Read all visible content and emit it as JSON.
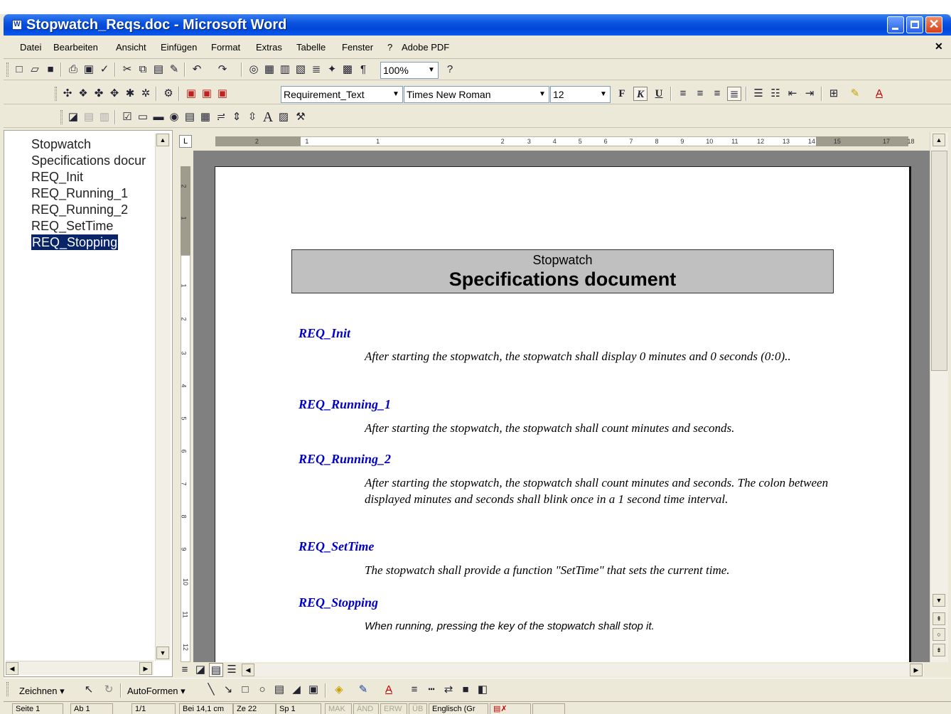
{
  "window": {
    "title": "Stopwatch_Reqs.doc - Microsoft Word"
  },
  "menu": [
    "Datei",
    "Bearbeiten",
    "Ansicht",
    "Einfügen",
    "Format",
    "Extras",
    "Tabelle",
    "Fenster",
    "?",
    "Adobe PDF"
  ],
  "toolbar": {
    "zoom": "100%",
    "style": "Requirement_Text",
    "font": "Times New Roman",
    "size": "12",
    "bold": "F",
    "italic": "K",
    "underline": "U"
  },
  "navigation": {
    "items": [
      "Stopwatch",
      "Specifications docur",
      "REQ_Init",
      "REQ_Running_1",
      "REQ_Running_2",
      "REQ_SetTime",
      "REQ_Stopping"
    ],
    "selected_index": 6
  },
  "document": {
    "heading_small": "Stopwatch",
    "heading_big": "Specifications document",
    "requirements": [
      {
        "id": "REQ_Init",
        "text": "After starting the stopwatch, the stopwatch shall display 0 minutes and 0 seconds (0:0).."
      },
      {
        "id": "REQ_Running_1",
        "text": "After starting the stopwatch, the stopwatch shall count minutes and seconds."
      },
      {
        "id": "REQ_Running_2",
        "text": "After starting the stopwatch, the stopwatch shall count minutes and seconds. The colon between displayed minutes and seconds shall blink once in a 1 second time interval."
      },
      {
        "id": "REQ_SetTime",
        "text": "The stopwatch shall provide a function \"SetTime\" that sets the current time."
      },
      {
        "id": "REQ_Stopping",
        "text": "When running, pressing the key of the stopwatch shall stop it."
      }
    ]
  },
  "ruler": {
    "h_labels": [
      "2",
      "1",
      "1",
      "2",
      "3",
      "4",
      "5",
      "6",
      "7",
      "8",
      "9",
      "10",
      "11",
      "12",
      "13",
      "14",
      "15",
      "17",
      "18"
    ],
    "v_labels": [
      "2",
      "1",
      "1",
      "2",
      "3",
      "4",
      "5",
      "6",
      "7",
      "8",
      "9",
      "10",
      "11",
      "12"
    ]
  },
  "drawing": {
    "draw_label": "Zeichnen",
    "autoshapes_label": "AutoFormen"
  },
  "status": {
    "page": "Seite 1",
    "section": "Ab 1",
    "pages": "1/1",
    "position": "Bei 14,1 cm",
    "line": "Ze 22",
    "column": "Sp 1",
    "mak": "MAK",
    "and": "ÄND",
    "erw": "ERW",
    "ub": "ÜB",
    "language": "Englisch (Gr"
  },
  "colors": {
    "title_blue": "#0a54e0",
    "req_blue": "#0000c8",
    "selection": "#0a246a"
  }
}
